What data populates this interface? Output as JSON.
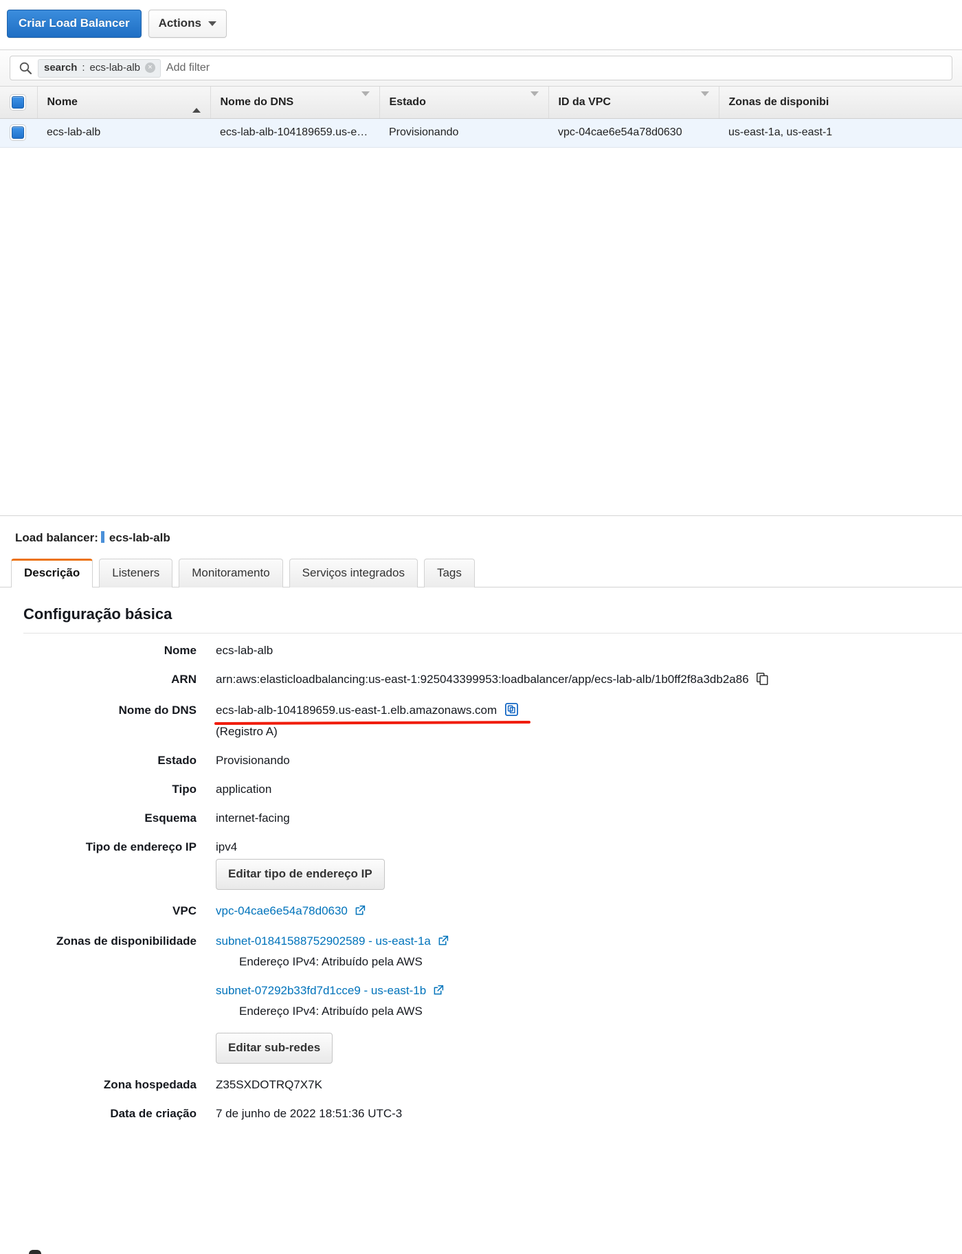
{
  "toolbar": {
    "create_button": "Criar Load Balancer",
    "actions_button": "Actions",
    "caret_icon": "chevron-down-icon"
  },
  "search": {
    "icon": "search-icon",
    "token_key": "search",
    "token_sep": ":",
    "token_value": "ecs-lab-alb",
    "token_clear": "×",
    "placeholder": "Add filter"
  },
  "table": {
    "columns": [
      {
        "label": "Nome",
        "sort": "asc"
      },
      {
        "label": "Nome do DNS",
        "sort": "none"
      },
      {
        "label": "Estado",
        "sort": "none"
      },
      {
        "label": "ID da VPC",
        "sort": "none"
      },
      {
        "label": "Zonas de disponibi",
        "sort": "none"
      }
    ],
    "rows": [
      {
        "nome": "ecs-lab-alb",
        "dns": "ecs-lab-alb-104189659.us-e…",
        "estado": "Provisionando",
        "vpc": "vpc-04cae6e54a78d0630",
        "az": "us-east-1a, us-east-1"
      }
    ]
  },
  "detail": {
    "label": "Load balancer:",
    "name": "ecs-lab-alb",
    "tabs": [
      {
        "label": "Descrição",
        "active": true
      },
      {
        "label": "Listeners",
        "active": false
      },
      {
        "label": "Monitoramento",
        "active": false
      },
      {
        "label": "Serviços integrados",
        "active": false
      },
      {
        "label": "Tags",
        "active": false
      }
    ],
    "section_title": "Configuração básica",
    "fields": {
      "nome_label": "Nome",
      "nome_value": "ecs-lab-alb",
      "arn_label": "ARN",
      "arn_value": "arn:aws:elasticloadbalancing:us-east-1:925043399953:loadbalancer/app/ecs-lab-alb/1b0ff2f8a3db2a86",
      "dns_label": "Nome do DNS",
      "dns_value": "ecs-lab-alb-104189659.us-east-1.elb.amazonaws.com",
      "dns_sub": "(Registro A)",
      "estado_label": "Estado",
      "estado_value": "Provisionando",
      "tipo_label": "Tipo",
      "tipo_value": "application",
      "esquema_label": "Esquema",
      "esquema_value": "internet-facing",
      "iptype_label": "Tipo de endereço IP",
      "iptype_value": "ipv4",
      "edit_iptype_button": "Editar tipo de endereço IP",
      "vpc_label": "VPC",
      "vpc_value": "vpc-04cae6e54a78d0630",
      "az_label": "Zonas de disponibilidade",
      "subnet_a": "subnet-01841588752902589 - us-east-1a",
      "subnet_a_ipv4": "Endereço IPv4: Atribuído pela AWS",
      "subnet_b": "subnet-07292b33fd7d1cce9 - us-east-1b",
      "subnet_b_ipv4": "Endereço IPv4: Atribuído pela AWS",
      "edit_subnets_button": "Editar sub-redes",
      "hosted_label": "Zona hospedada",
      "hosted_value": "Z35SXDOTRQ7X7K",
      "created_label": "Data de criação",
      "created_value": "7 de junho de 2022 18:51:36 UTC-3"
    }
  },
  "colors": {
    "primary_button": "#1f6fc4",
    "link": "#0073bb",
    "active_tab_accent": "#ec7211",
    "annotation_underline": "#f01c0a",
    "row_selected": "#eef5fd"
  }
}
